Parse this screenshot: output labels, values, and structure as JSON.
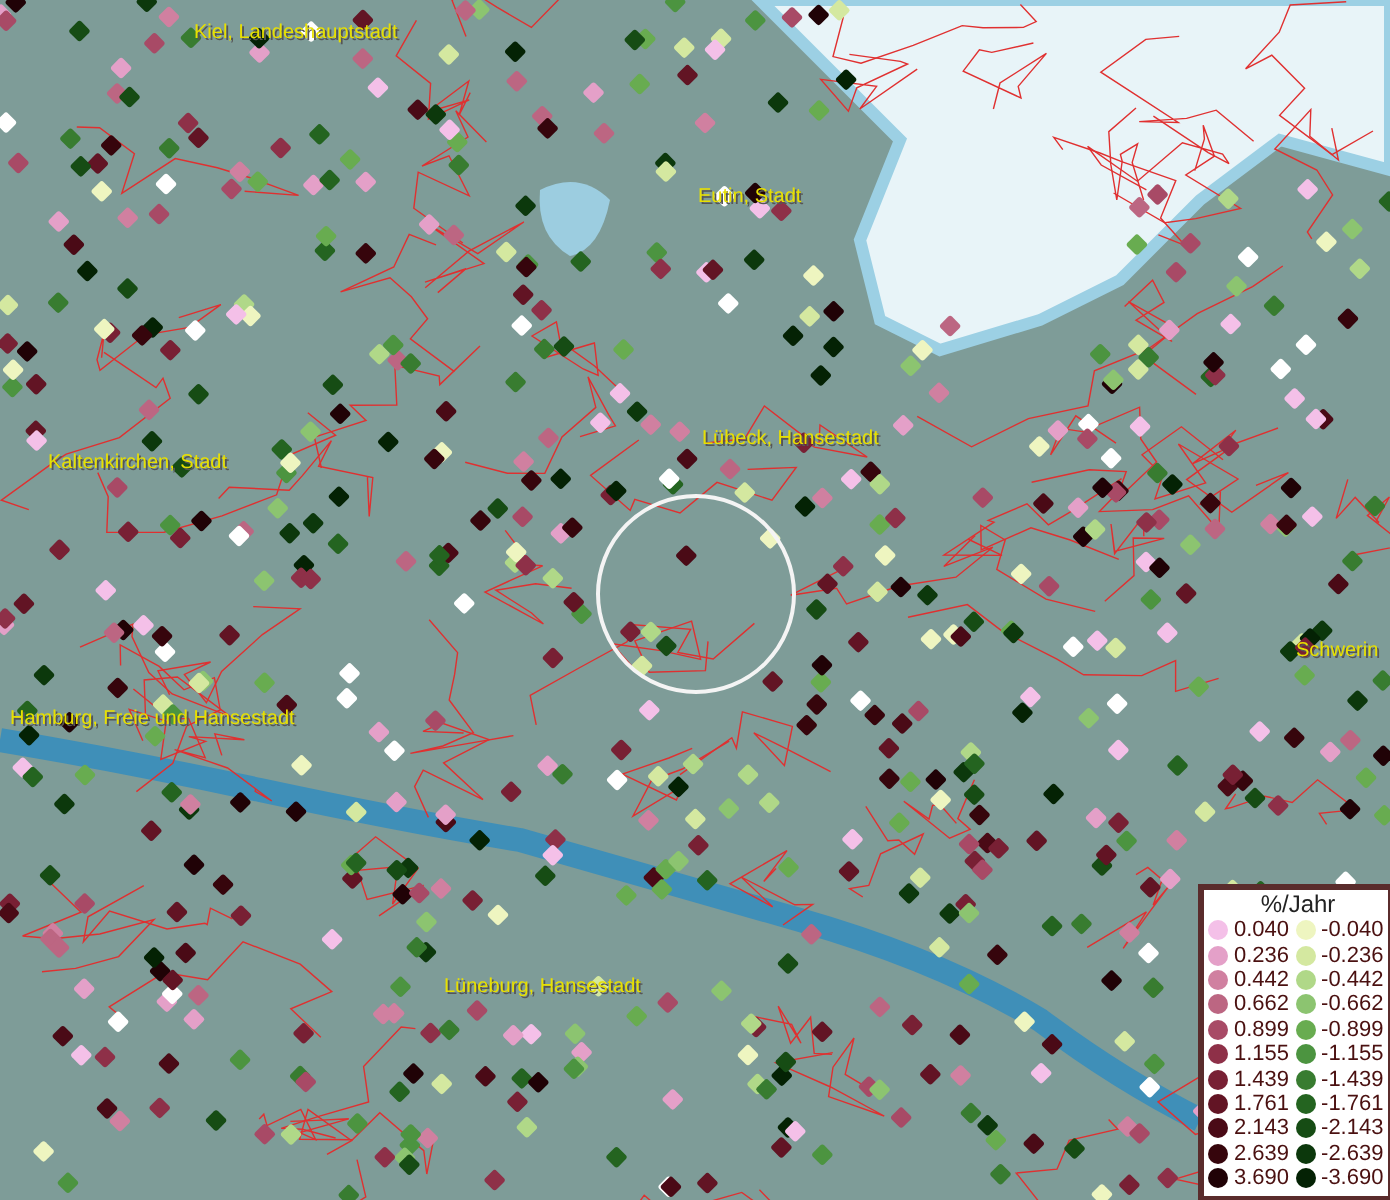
{
  "map": {
    "places": [
      {
        "name": "Kiel, Landeshauptstadt"
      },
      {
        "name": "Eutin, Stadt"
      },
      {
        "name": "Lübeck, Hansestadt"
      },
      {
        "name": "Kaltenkirchen, Stadt"
      },
      {
        "name": "Schwerin"
      },
      {
        "name": "Hamburg, Freie und Hansestadt"
      },
      {
        "name": "Lüneburg, Hansestadt"
      }
    ]
  },
  "legend": {
    "title": "%/Jahr",
    "positive": [
      {
        "label": "0.040",
        "color": "#f4c0e8"
      },
      {
        "label": "0.236",
        "color": "#e4a0c8"
      },
      {
        "label": "0.442",
        "color": "#d080a0"
      },
      {
        "label": "0.662",
        "color": "#bc6682"
      },
      {
        "label": "0.899",
        "color": "#a84a66"
      },
      {
        "label": "1.155",
        "color": "#8e3048"
      },
      {
        "label": "1.439",
        "color": "#782034"
      },
      {
        "label": "1.761",
        "color": "#621424"
      },
      {
        "label": "2.143",
        "color": "#4a0a16"
      },
      {
        "label": "2.639",
        "color": "#36050c"
      },
      {
        "label": "3.690",
        "color": "#200206"
      }
    ],
    "negative": [
      {
        "label": "-0.040",
        "color": "#eef5c0"
      },
      {
        "label": "-0.236",
        "color": "#d4e8a0"
      },
      {
        "label": "-0.442",
        "color": "#b0d888"
      },
      {
        "label": "-0.662",
        "color": "#8cc470"
      },
      {
        "label": "-0.899",
        "color": "#68ac50"
      },
      {
        "label": "-1.155",
        "color": "#4c9440"
      },
      {
        "label": "-1.439",
        "color": "#387c30"
      },
      {
        "label": "-1.761",
        "color": "#246420"
      },
      {
        "label": "-2.143",
        "color": "#164c14"
      },
      {
        "label": "-2.639",
        "color": "#0c380c"
      },
      {
        "label": "-3.690",
        "color": "#042204"
      }
    ]
  }
}
